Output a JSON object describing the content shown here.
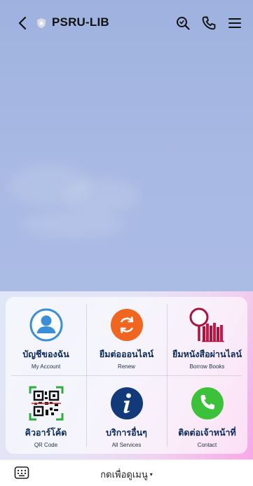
{
  "header": {
    "title": "PSRU-LIB",
    "icons": [
      "back-arrow-icon",
      "shield-badge-icon",
      "search-icon",
      "phone-icon",
      "hamburger-menu-icon"
    ]
  },
  "menu": {
    "items": [
      {
        "th": "บัญชีของฉัน",
        "en": "My Account",
        "icon": "user-icon",
        "color": "#3a8fd8"
      },
      {
        "th": "ยืมต่อออนไลน์",
        "en": "Renew",
        "icon": "renew-icon",
        "color": "#f0651f"
      },
      {
        "th": "ยืมหนังสือผ่านไลน์",
        "en": "Borrow Books",
        "icon": "book-search-icon",
        "color": "#b0123c"
      },
      {
        "th": "คิวอาร์โค้ด",
        "en": "QR Code",
        "icon": "qr-code-icon",
        "color": "#2fae3a"
      },
      {
        "th": "บริการอื่นๆ",
        "en": "All Services",
        "icon": "info-icon",
        "color": "#123a7a"
      },
      {
        "th": "ติดต่อเจ้าหน้าที่",
        "en": "Contact",
        "icon": "phone-call-icon",
        "color": "#3cc13a"
      }
    ]
  },
  "bottom": {
    "tap_menu": "กดเพื่อดูเมนู",
    "caret": "▾"
  }
}
